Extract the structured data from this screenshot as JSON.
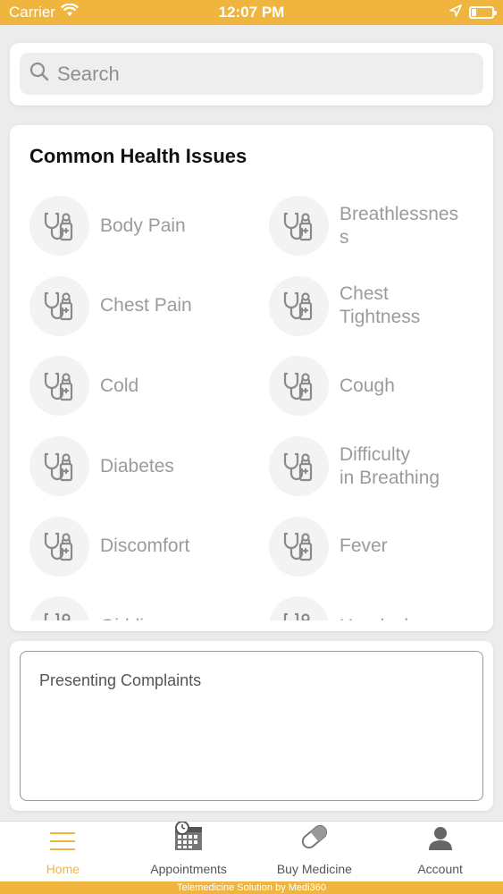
{
  "status_bar": {
    "carrier": "Carrier",
    "time": "12:07 PM"
  },
  "search": {
    "placeholder": "Search"
  },
  "health_issues": {
    "title": "Common Health Issues",
    "items": [
      {
        "label": "Body Pain"
      },
      {
        "label": "Breathlessnes\ns"
      },
      {
        "label": "Chest Pain"
      },
      {
        "label": "Chest\nTightness"
      },
      {
        "label": "Cold"
      },
      {
        "label": "Cough"
      },
      {
        "label": "Diabetes"
      },
      {
        "label": "Difficulty\nin Breathing"
      },
      {
        "label": "Discomfort"
      },
      {
        "label": "Fever"
      },
      {
        "label": "Giddiness"
      },
      {
        "label": "Headache"
      }
    ],
    "icon": "stethoscope-icon"
  },
  "complaints": {
    "placeholder": "Presenting Complaints"
  },
  "tab_bar": {
    "tabs": [
      {
        "label": "Home",
        "icon": "menu-icon",
        "active": true
      },
      {
        "label": "Appointments",
        "icon": "calendar-clock-icon",
        "active": false
      },
      {
        "label": "Buy Medicine",
        "icon": "pill-icon",
        "active": false
      },
      {
        "label": "Account",
        "icon": "user-icon",
        "active": false
      }
    ]
  },
  "footer": {
    "text": "Telemedicine Solution by Medi360"
  },
  "colors": {
    "accent": "#efb53e",
    "label_gray": "#9b9b9b",
    "background": "#ececec"
  }
}
